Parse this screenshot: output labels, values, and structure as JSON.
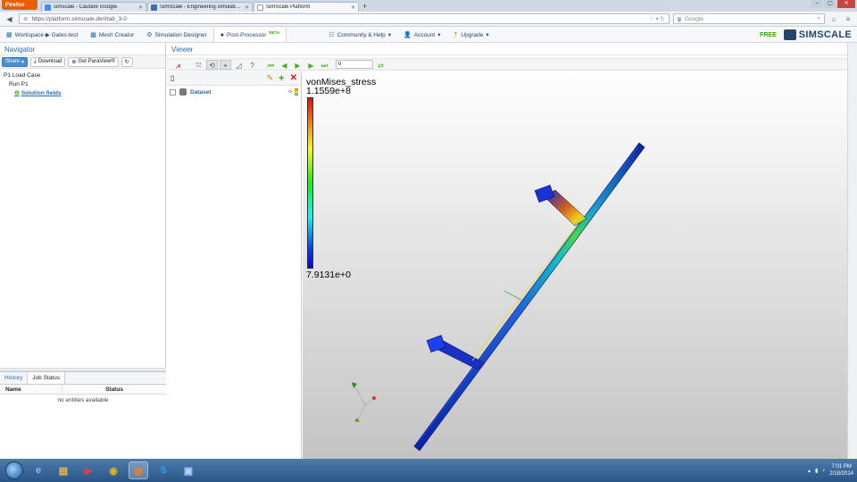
{
  "browser": {
    "menu_button": "Firefox",
    "tabs": [
      {
        "label": "simscale - Căutare Google",
        "icon": "google-icon",
        "active": false
      },
      {
        "label": "SimScale - Engineering simulation in ...",
        "icon": "simscale-icon",
        "active": false
      },
      {
        "label": "SimScale Platform",
        "icon": "simscale-icon",
        "active": true
      }
    ],
    "url": "https://platform.simscale.de/#tab_3-0",
    "search_placeholder": "Google"
  },
  "app": {
    "nav_tabs": [
      {
        "label": "Workspace ▶ Gales-test"
      },
      {
        "label": "Mesh Creator"
      },
      {
        "label": "Simulation Designer"
      },
      {
        "label": "Post-Processor",
        "badge": "BETA"
      }
    ],
    "menus": [
      "Community & Help",
      "Account",
      "Upgrade"
    ],
    "plan": "FREE",
    "logo_text": "SIMSCALE"
  },
  "navigator": {
    "title": "Navigator",
    "buttons": {
      "share": "Share",
      "download": "Download",
      "paraview": "Get ParaView®"
    },
    "tree": {
      "load_case": "P1 Load Case",
      "run": "Run P1",
      "solution": "Solution fields"
    }
  },
  "bottom": {
    "tabs": [
      "History",
      "Job Status"
    ],
    "columns": [
      "Name",
      "Status"
    ],
    "empty": "no entities available"
  },
  "viewer": {
    "title": "Viewer",
    "frame_value": "0",
    "dataset_label": "Dataset"
  },
  "colorbar": {
    "field": "vonMises_stress",
    "max": "1.1559e+8",
    "min": "7.9131e+0"
  },
  "taskbar": {
    "time": "7:01 PM",
    "date": "2/18/2014"
  },
  "colors": {
    "accent": "#2a6aaa",
    "brand": "#24466b",
    "free": "#3aa800"
  }
}
